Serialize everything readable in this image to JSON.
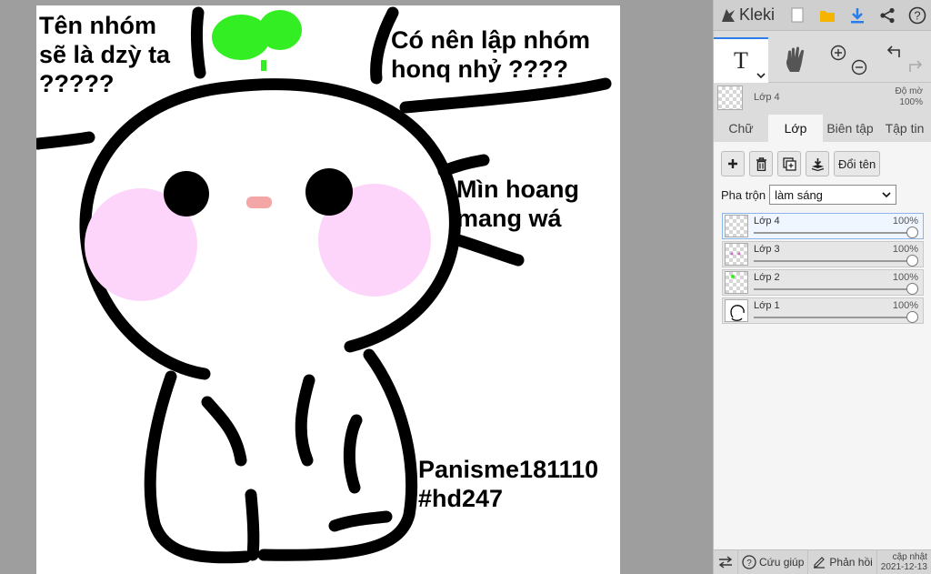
{
  "app": {
    "name": "Kleki"
  },
  "canvas_text": {
    "caption_top_left": [
      "Tên nhóm",
      "sẽ là dzỳ ta",
      "?????"
    ],
    "caption_top_right": [
      "Có nên lập nhóm",
      "honq nhỷ ????"
    ],
    "caption_middle_right": [
      "Mìn hoang",
      "mang wá"
    ],
    "caption_bottom_right": [
      "Panisme181110",
      "#hd247"
    ]
  },
  "colors": {
    "outline": "#000000",
    "sprout": "#33ee22",
    "blush": "#fdd5fb",
    "nose": "#f4a6a6",
    "accent": "#2b7de9"
  },
  "toolbar": {
    "icons": [
      "new-image-icon",
      "open-folder-icon",
      "download-icon",
      "share-icon",
      "help-icon"
    ]
  },
  "tools": {
    "text_tool_glyph": "T"
  },
  "current_layer": {
    "name": "Lớp 4",
    "opacity_label": "Độ mờ",
    "opacity": "100%"
  },
  "tabs": [
    "Chữ",
    "Lớp",
    "Biên tập",
    "Tập tin"
  ],
  "active_tab": "Lớp",
  "layer_buttons": {
    "rename_label": "Đổi tên"
  },
  "blend": {
    "label": "Pha trộn",
    "value": "làm sáng"
  },
  "layers": [
    {
      "name": "Lớp 4",
      "opacity": "100%",
      "selected": true
    },
    {
      "name": "Lớp 3",
      "opacity": "100%",
      "selected": false
    },
    {
      "name": "Lớp 2",
      "opacity": "100%",
      "selected": false
    },
    {
      "name": "Lớp 1",
      "opacity": "100%",
      "selected": false
    }
  ],
  "bottom_bar": {
    "help_label": "Cứu giúp",
    "feedback_label": "Phản hồi",
    "update_label": "cập nhật",
    "update_date": "2021-12-13"
  }
}
